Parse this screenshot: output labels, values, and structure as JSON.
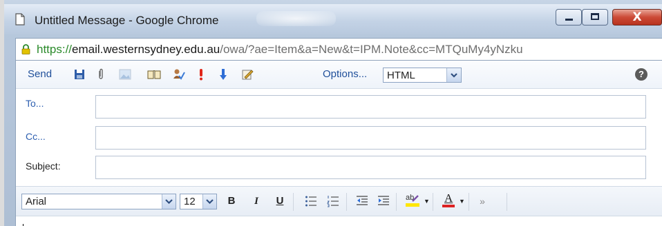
{
  "window": {
    "title": "Untitled Message - Google Chrome",
    "controls": {
      "close_label": "X"
    }
  },
  "address": {
    "scheme": "https://",
    "host": "email.westernsydney.edu.au",
    "path": "/owa/?ae=Item&a=New&t=IPM.Note&cc=MTQuMy4yNzku"
  },
  "toolbar": {
    "send_label": "Send",
    "options_label": "Options...",
    "format_value": "HTML",
    "help_label": "?"
  },
  "headers": {
    "to_label": "To...",
    "cc_label": "Cc...",
    "subject_label": "Subject:",
    "to_value": "",
    "cc_value": "",
    "subject_value": ""
  },
  "format": {
    "font_value": "Arial",
    "size_value": "12",
    "bold": "B",
    "italic": "I",
    "underline": "U",
    "font_color_glyph": "A",
    "highlight_glyph": "ab",
    "more_glyph": "»"
  },
  "colors": {
    "link": "#2d5fb0",
    "close_button": "#cc4a36",
    "secure_green": "#2a8a2a",
    "font_color_underline": "#d22",
    "highlight": "#ffe600"
  }
}
